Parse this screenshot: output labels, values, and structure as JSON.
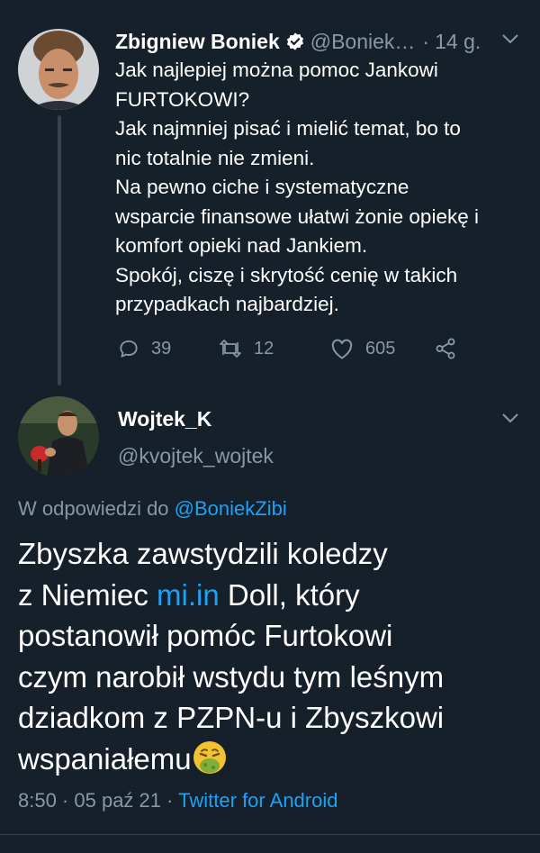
{
  "tweet1": {
    "author_name": "Zbigniew Boniek",
    "author_handle": "@Boniek…",
    "time_sep": "·",
    "time": "14 g.",
    "text_lines": [
      "Jak najlepiej można pomoc Jankowi",
      "FURTOKOWI?",
      "Jak najmniej pisać i mielić temat, bo to",
      "nic totalnie nie zmieni.",
      "Na pewno ciche i systematyczne",
      "wsparcie finansowe ułatwi żonie opiekę i",
      "komfort opieki nad Jankiem.",
      "Spokój, ciszę i skrytość cenię w takich",
      "przypadkach najbardziej."
    ],
    "replies": "39",
    "retweets": "12",
    "likes": "605",
    "icons": [
      "verified-icon",
      "chevron-down-icon",
      "reply-icon",
      "retweet-icon",
      "like-icon",
      "share-icon"
    ]
  },
  "tweet2": {
    "author_name": "Wojtek_K",
    "author_handle": "@kvojtek_wojtek",
    "reply_prefix": "W odpowiedzi do ",
    "reply_to": "@BoniekZibi",
    "text": {
      "line1": "Zbyszka zawstydzili koledzy",
      "line2_pre": "z Niemiec ",
      "line2_link": "mi.in",
      "line2_post": " Doll, który",
      "line3": "postanowił pomóc Furtokowi",
      "line4": "czym narobił wstydu tym leśnym",
      "line5": "dziadkom z PZPN-u i Zbyszkowi",
      "line6": "wspaniałemu"
    },
    "emoji": "nauseated-face-emoji",
    "timestamp": "8:50 · 05 paź 21 · ",
    "source": "Twitter for Android"
  },
  "colors": {
    "background": "#15202b",
    "text": "#ffffff",
    "secondary": "#8899a6",
    "link": "#1da1f2",
    "divider": "#38444d"
  }
}
